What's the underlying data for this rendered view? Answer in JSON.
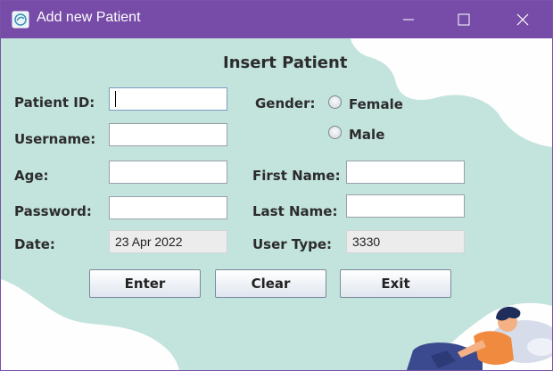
{
  "window": {
    "title": "Add new Patient"
  },
  "form": {
    "heading": "Insert Patient",
    "patient_id_label": "Patient ID:",
    "patient_id_value": "",
    "username_label": "Username:",
    "username_value": "",
    "age_label": "Age:",
    "age_value": "",
    "password_label": "Password:",
    "password_value": "",
    "date_label": "Date:",
    "date_value": "23 Apr 2022",
    "gender_label": "Gender:",
    "gender_options": [
      "Female",
      "Male"
    ],
    "first_name_label": "First Name:",
    "first_name_value": "",
    "last_name_label": "Last Name:",
    "last_name_value": "",
    "user_type_label": "User Type:",
    "user_type_value": "3330"
  },
  "buttons": {
    "enter": "Enter",
    "clear": "Clear",
    "exit": "Exit"
  },
  "colors": {
    "titlebar": "#774ca8",
    "background_shape": "#c3e3dd"
  }
}
